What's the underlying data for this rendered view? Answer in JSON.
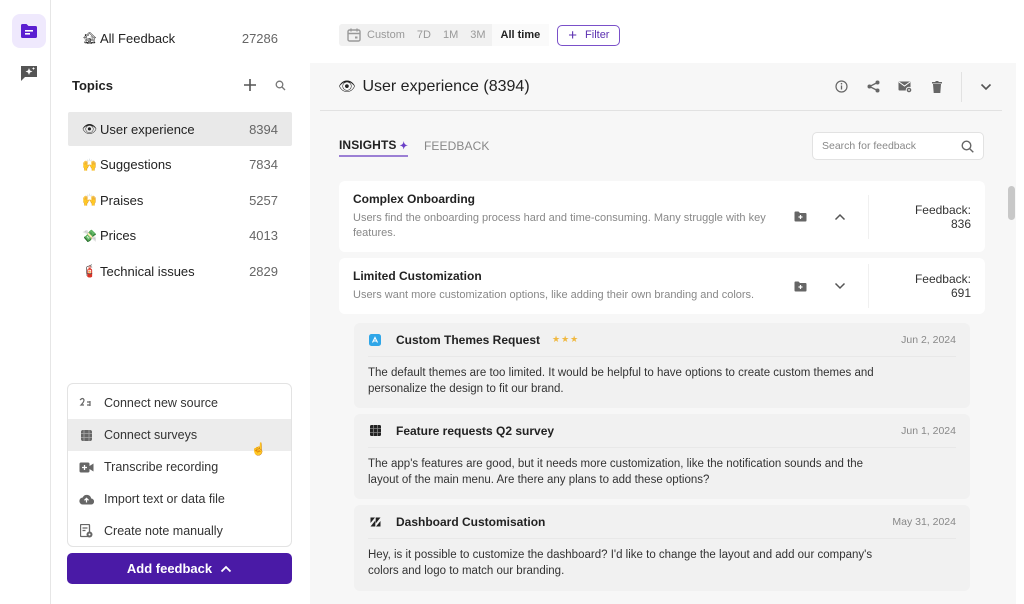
{
  "rail": {
    "items": [
      {
        "name": "feedback-folder",
        "active": true
      },
      {
        "name": "ai-chat",
        "active": false
      }
    ]
  },
  "sidebar": {
    "all_feedback": {
      "emoji": "🏚",
      "label": "All Feedback",
      "count": "27286"
    },
    "topics_title": "Topics",
    "topics": [
      {
        "emoji": "👁",
        "label": "User experience",
        "count": "8394",
        "active": true
      },
      {
        "emoji": "🙌",
        "label": "Suggestions",
        "count": "7834",
        "active": false
      },
      {
        "emoji": "🙌",
        "label": "Praises",
        "count": "5257",
        "active": false
      },
      {
        "emoji": "💸",
        "label": "Prices",
        "count": "4013",
        "active": false
      },
      {
        "emoji": "🧯",
        "label": "Technical issues",
        "count": "2829",
        "active": false
      }
    ],
    "add_menu": [
      {
        "icon": "plug-icon",
        "label": "Connect new source"
      },
      {
        "icon": "survey-icon",
        "label": "Connect surveys"
      },
      {
        "icon": "video-icon",
        "label": "Transcribe recording"
      },
      {
        "icon": "cloud-upload-icon",
        "label": "Import text or data file"
      },
      {
        "icon": "note-icon",
        "label": "Create note manually"
      }
    ],
    "add_button": "Add feedback"
  },
  "topbar": {
    "custom_label": "Custom",
    "ranges": [
      "7D",
      "1M",
      "3M",
      "All time"
    ],
    "active_range": "All time",
    "filter_label": "Filter"
  },
  "main": {
    "title": "User experience (8394)",
    "title_emoji": "👁",
    "tabs": [
      {
        "label": "INSIGHTS",
        "active": true
      },
      {
        "label": "FEEDBACK",
        "active": false
      }
    ],
    "search_placeholder": "Search for feedback",
    "insights": [
      {
        "title": "Complex Onboarding",
        "description": "Users find the onboarding process hard and time-consuming. Many struggle with key features.",
        "feedback_count": "Feedback: 836",
        "expanded": true
      },
      {
        "title": "Limited Customization",
        "description": "Users want more customization options, like adding their own branding and colors.",
        "feedback_count": "Feedback: 691",
        "expanded": false
      }
    ],
    "feedback_items": [
      {
        "source": "app-store",
        "title": "Custom Themes Request",
        "stars": "★★★",
        "date": "Jun 2, 2024",
        "body": "The default themes are too limited. It would be helpful to have options to create custom themes and personalize the design to fit our brand."
      },
      {
        "source": "survey",
        "title": "Feature requests Q2 survey",
        "stars": "",
        "date": "Jun 1, 2024",
        "body": "The app's features are good, but it needs more customization, like the notification sounds and the layout of the main menu. Are there any plans to add these options?"
      },
      {
        "source": "zendesk",
        "title": "Dashboard Customisation",
        "stars": "",
        "date": "May 31, 2024",
        "body": "Hey, is it possible to customize the dashboard? I'd like to change the layout and add our company's colors and logo to match our branding."
      }
    ]
  },
  "colors": {
    "accent": "#4a1aa6",
    "accent_light": "#efe9fd",
    "star": "#f0b840"
  }
}
